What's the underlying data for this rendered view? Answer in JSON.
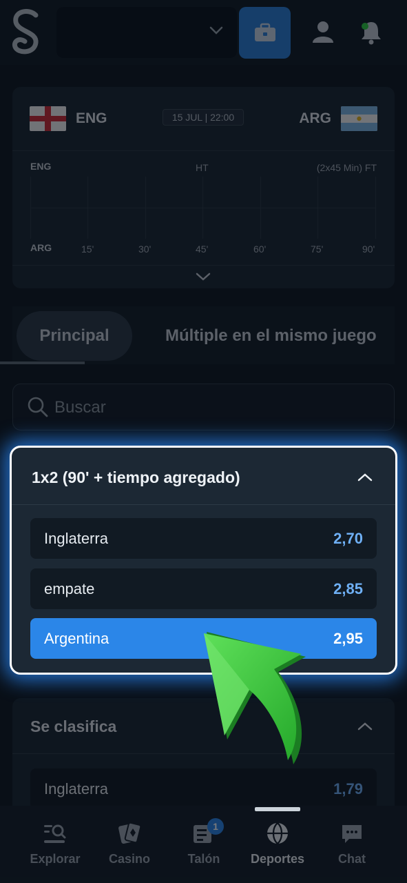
{
  "match": {
    "home_code": "ENG",
    "away_code": "ARG",
    "datetime": "15 JUL | 22:00",
    "timeline": {
      "home": "ENG",
      "away": "ARG",
      "ht": "HT",
      "ft": "(2x45 Min) FT",
      "ticks": [
        "15'",
        "30'",
        "45'",
        "60'",
        "75'",
        "90'"
      ]
    }
  },
  "tabs": [
    "Principal",
    "Múltiple en el mismo juego"
  ],
  "search": {
    "placeholder": "Buscar"
  },
  "markets": [
    {
      "title": "1x2 (90' + tiempo agregado)",
      "selections": [
        {
          "name": "Inglaterra",
          "odds": "2,70"
        },
        {
          "name": "empate",
          "odds": "2,85"
        },
        {
          "name": "Argentina",
          "odds": "2,95",
          "selected": true
        }
      ]
    },
    {
      "title": "Se clasifica",
      "selections": [
        {
          "name": "Inglaterra",
          "odds": "1,79"
        }
      ]
    }
  ],
  "bottom_nav": [
    {
      "label": "Explorar",
      "icon": "explore-icon"
    },
    {
      "label": "Casino",
      "icon": "casino-icon"
    },
    {
      "label": "Talón",
      "icon": "betslip-icon",
      "badge": "1"
    },
    {
      "label": "Deportes",
      "icon": "sports-icon",
      "active": true
    },
    {
      "label": "Chat",
      "icon": "chat-icon"
    }
  ],
  "colors": {
    "accent": "#2b86e8",
    "odds": "#6fb0f5",
    "background": "#0e1720",
    "arrow": "#3cc43c",
    "notification_dot": "#2ecc40"
  }
}
